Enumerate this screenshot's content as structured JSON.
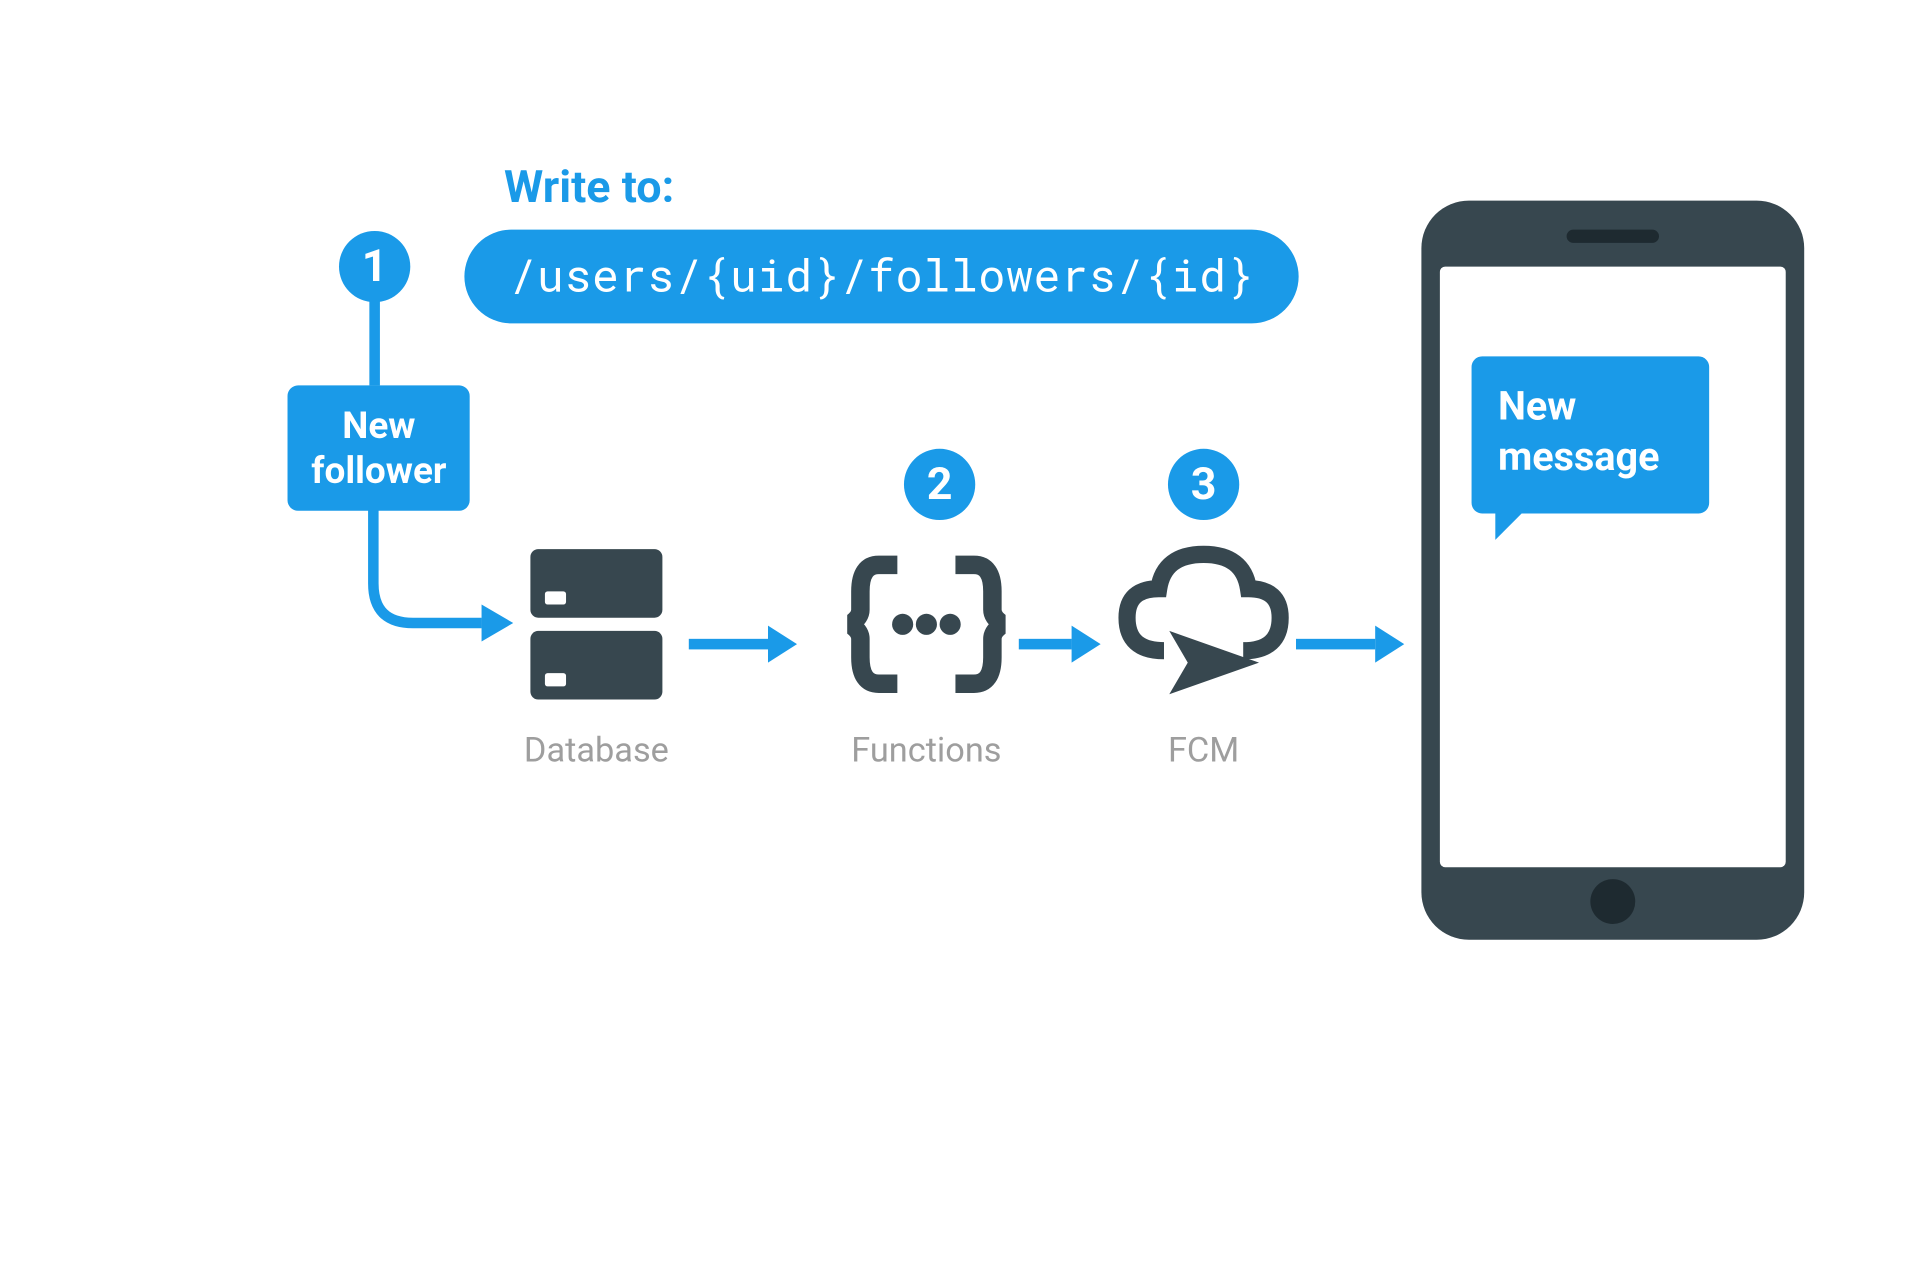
{
  "header": {
    "write_label": "Write to:",
    "path": "/users/{uid}/followers/{id}"
  },
  "badges": {
    "one": "1",
    "two": "2",
    "three": "3"
  },
  "trigger": {
    "line1": "New",
    "line2": "follower"
  },
  "nodes": {
    "database_label": "Database",
    "functions_label": "Functions",
    "fcm_label": "FCM"
  },
  "notification": {
    "line1": "New",
    "line2": "message"
  },
  "colors": {
    "accent": "#1a9ae8",
    "icon": "#37474f",
    "label": "#9e9e9e"
  }
}
